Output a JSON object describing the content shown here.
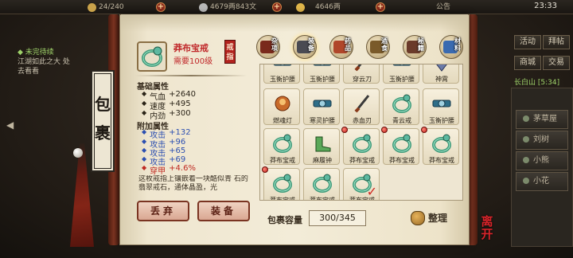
{
  "topbar": {
    "stamina": "24/240",
    "silver": "4679两843文",
    "gold": "4646两",
    "notice": "公告",
    "clock": "23:33"
  },
  "right_menu": {
    "buttons": [
      "活动",
      "拜帖",
      "商城",
      "交易"
    ],
    "location": "长白山",
    "location_time": "[5:34]",
    "list": [
      "茅草屋",
      "刘树",
      "小熊",
      "小花"
    ]
  },
  "quest": {
    "title": "◆ 未完待续",
    "desc": "江湖如此之大 处去看看"
  },
  "panel": {
    "title_chars": [
      "包",
      "裹"
    ],
    "item": {
      "name": "莽布宝戒",
      "requirement": "需要100级",
      "type_badge": "戒指"
    },
    "base_title": "基础属性",
    "base_stats": [
      {
        "label": "气血",
        "value": "+2640"
      },
      {
        "label": "速度",
        "value": "+495"
      },
      {
        "label": "内劲",
        "value": "+300"
      }
    ],
    "extra_title": "附加属性",
    "extra_stats": [
      {
        "label": "攻击",
        "value": "+132"
      },
      {
        "label": "攻击",
        "value": "+96"
      },
      {
        "label": "攻击",
        "value": "+65"
      },
      {
        "label": "攻击",
        "value": "+69"
      },
      {
        "label": "穿甲",
        "value": "+4.6%"
      }
    ],
    "description": "这枚戒指上镶嵌着一块酷似青 石的翡翠戒石，通体晶盈，光",
    "discard_button": "丢弃",
    "equip_button": "装备"
  },
  "tabs": [
    {
      "label": "杂项",
      "color": "#7a2a1c"
    },
    {
      "label": "装备",
      "color": "#4a4a52"
    },
    {
      "label": "药品",
      "color": "#b0462a"
    },
    {
      "label": "酒食",
      "color": "#7a5a2a"
    },
    {
      "label": "秘籍",
      "color": "#6a3a2a"
    },
    {
      "label": "材料",
      "color": "#3a6ab0"
    }
  ],
  "grid": {
    "items": [
      {
        "label": "玉衡护腰",
        "icon": "belt-icon",
        "pin": false,
        "partial": true
      },
      {
        "label": "玉衡护腰",
        "icon": "belt-icon",
        "pin": false,
        "partial": true
      },
      {
        "label": "穿云刀",
        "icon": "blade-icon",
        "pin": false,
        "partial": true
      },
      {
        "label": "玉衡护腰",
        "icon": "belt-icon",
        "pin": false,
        "partial": true
      },
      {
        "label": "神霄",
        "icon": "gem-icon",
        "pin": false,
        "partial": true
      },
      {
        "label": "燃魂灯",
        "icon": "lamp-icon",
        "pin": false
      },
      {
        "label": "寒灵护腰",
        "icon": "belt-icon",
        "pin": false
      },
      {
        "label": "赤血刃",
        "icon": "blade-icon",
        "pin": false
      },
      {
        "label": "青云戒",
        "icon": "ring-icon",
        "pin": false
      },
      {
        "label": "玉衡护腰",
        "icon": "belt-icon",
        "pin": false
      },
      {
        "label": "莽布宝戒",
        "icon": "ring-icon",
        "pin": false
      },
      {
        "label": "麻履钟",
        "icon": "shoe-icon",
        "pin": false
      },
      {
        "label": "莽布宝戒",
        "icon": "ring-icon",
        "pin": true
      },
      {
        "label": "莽布宝戒",
        "icon": "ring-icon",
        "pin": true
      },
      {
        "label": "莽布宝戒",
        "icon": "ring-icon",
        "pin": true
      },
      {
        "label": "莽布宝戒",
        "icon": "ring-icon",
        "pin": true
      },
      {
        "label": "莽布宝戒",
        "icon": "ring-icon",
        "pin": false
      },
      {
        "label": "莽布宝戒",
        "icon": "ring-icon",
        "pin": false,
        "check": true
      }
    ]
  },
  "footer": {
    "capacity_label": "包裹容量",
    "capacity": "300/345",
    "sort_button": "整理"
  },
  "seal_text": "离开",
  "colors": {
    "accent_red": "#c0282a",
    "blue_stat": "#2c4fb1",
    "ring_green": "#3f9a7a"
  }
}
